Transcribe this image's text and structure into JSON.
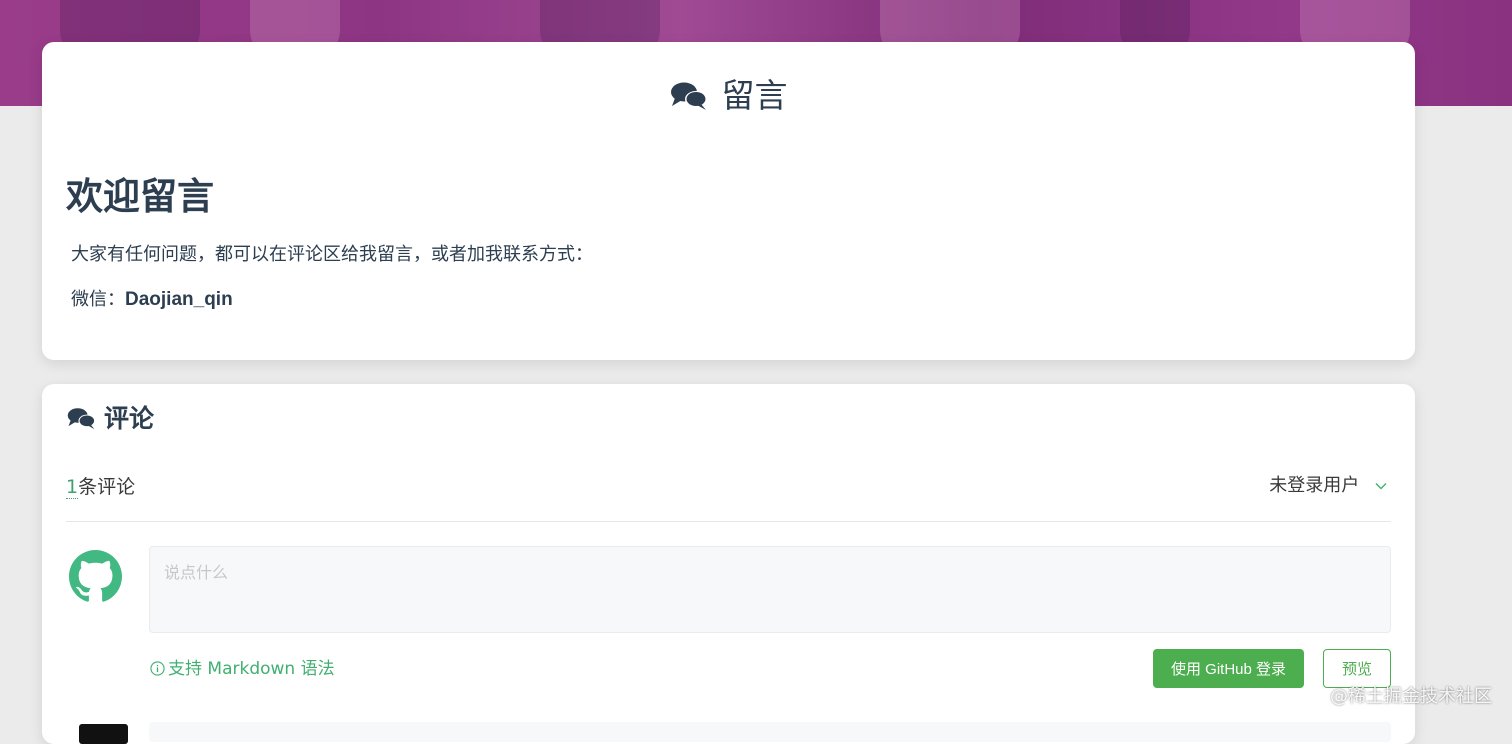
{
  "page": {
    "title": "留言"
  },
  "intro": {
    "heading": "欢迎留言",
    "message": "大家有任何问题，都可以在评论区给我留言，或者加我联系方式：",
    "wechat_label": "微信：",
    "wechat_id": "Daojian_qin"
  },
  "comments": {
    "heading": "评论",
    "count": "1",
    "count_suffix": "条评论",
    "user_menu_label": "未登录用户",
    "input_placeholder": "说点什么",
    "markdown_hint": "支持 Markdown 语法",
    "login_button": "使用 GitHub 登录",
    "preview_button": "预览"
  },
  "watermark": "@稀土掘金技术社区",
  "colors": {
    "accent_green": "#4cae4f",
    "link_green": "#40b070",
    "text_dark": "#2c3e50",
    "banner_purple": "#8d3583"
  },
  "icons": {
    "title_icon": "comments-icon",
    "avatar_icon": "github-icon",
    "hint_icon": "info-icon",
    "menu_icon": "chevron-down-icon"
  }
}
